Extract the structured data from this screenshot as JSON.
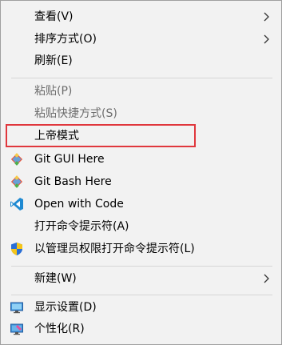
{
  "menu": {
    "items": [
      {
        "label": "查看(V)",
        "has_submenu": true,
        "disabled": false
      },
      {
        "label": "排序方式(O)",
        "has_submenu": true,
        "disabled": false
      },
      {
        "label": "刷新(E)",
        "has_submenu": false,
        "disabled": false
      },
      {
        "label": "粘贴(P)",
        "has_submenu": false,
        "disabled": true
      },
      {
        "label": "粘贴快捷方式(S)",
        "has_submenu": false,
        "disabled": true
      },
      {
        "label": "上帝模式",
        "has_submenu": false,
        "disabled": false,
        "highlighted": true
      },
      {
        "label": "Git GUI Here",
        "icon": "git-gui-icon",
        "disabled": false
      },
      {
        "label": "Git Bash Here",
        "icon": "git-bash-icon",
        "disabled": false
      },
      {
        "label": "Open with Code",
        "icon": "vscode-icon",
        "disabled": false
      },
      {
        "label": "打开命令提示符(A)",
        "disabled": false
      },
      {
        "label": "以管理员权限打开命令提示符(L)",
        "icon": "uac-shield-icon",
        "disabled": false
      },
      {
        "label": "新建(W)",
        "has_submenu": true,
        "disabled": false
      },
      {
        "label": "显示设置(D)",
        "icon": "display-settings-icon",
        "disabled": false
      },
      {
        "label": "个性化(R)",
        "icon": "personalize-icon",
        "disabled": false
      }
    ]
  },
  "colors": {
    "menu_bg": "#f2f2f2",
    "highlight_border": "#e0373d",
    "disabled_text": "#6d6d6d"
  }
}
